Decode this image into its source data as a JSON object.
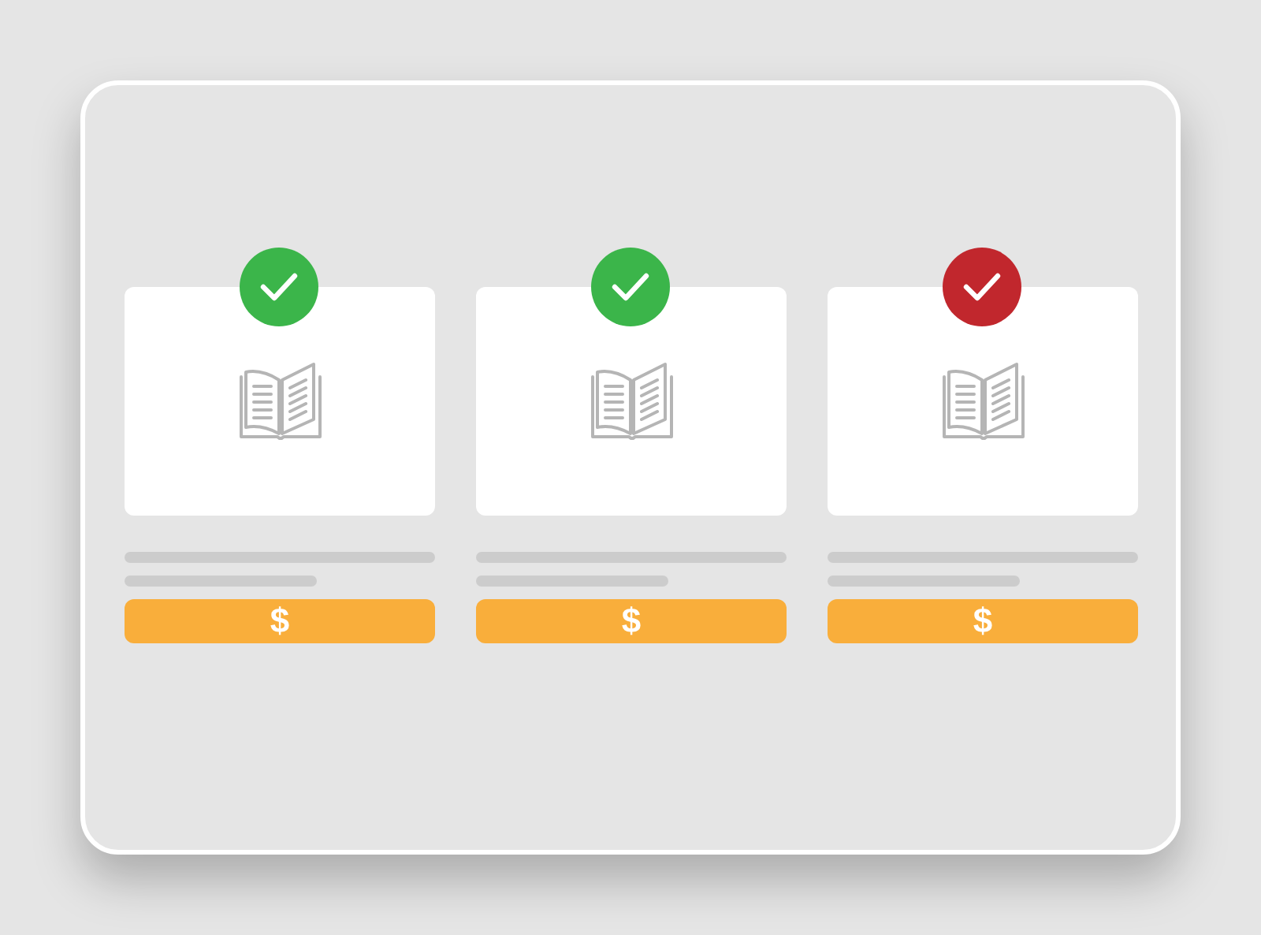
{
  "products": [
    {
      "color": "#3bb54a",
      "price_button": "$"
    },
    {
      "color": "#3bb54a",
      "price_button": "$"
    },
    {
      "color": "#c1272d",
      "price_button": "$"
    }
  ]
}
